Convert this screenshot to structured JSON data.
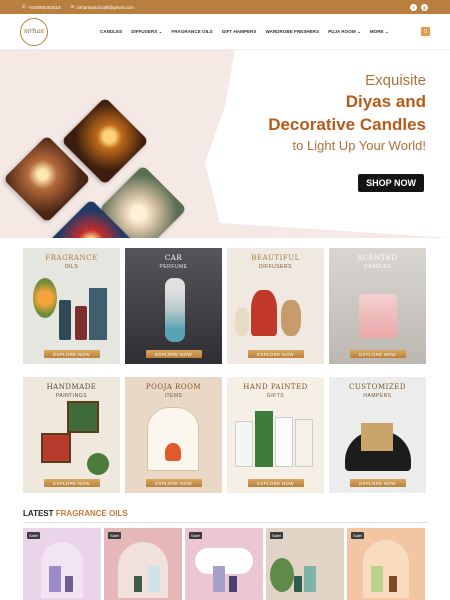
{
  "topbar": {
    "phone": "+916006263018",
    "email": "nirhanhandicraft@gmail.com"
  },
  "nav": {
    "logo_text": "nirhan",
    "items": [
      "CANDLES",
      "DIFFUSERS ⌄",
      "FRAGRANCE OILS",
      "GIFT HAMPERS",
      "WARDROBE FRESHERS",
      "PUJA ROOM ⌄",
      "MORE ⌄"
    ],
    "cart_count": "0"
  },
  "hero": {
    "line1": "Exquisite",
    "line2": "Diyas and",
    "line3": "Decorative Candles",
    "line4": "to Light Up Your World!",
    "button": "SHOP NOW"
  },
  "categories": [
    {
      "title": "FRAGRANCE",
      "sub": "OILS",
      "button": "EXPLORE NOW",
      "bg": "#e6e6e0",
      "title_color": "#a77b48"
    },
    {
      "title": "CAR",
      "sub": "PERFUME",
      "button": "EXPLORE NOW",
      "bg": "#4c4c52",
      "title_color": "#ffffff"
    },
    {
      "title": "BEAUTIFUL",
      "sub": "DIFFUSERS",
      "button": "EXPLORE NOW",
      "bg": "#efe9e1",
      "title_color": "#a77b48"
    },
    {
      "title": "SCENTED",
      "sub": "CANDLES",
      "button": "EXPLORE NOW",
      "bg": "#d9d6d2",
      "title_color": "#ffffff"
    },
    {
      "title": "HANDMADE",
      "sub": "PAINTINGS",
      "button": "EXPLORE NOW",
      "bg": "#eee8dd",
      "title_color": "#5a4630"
    },
    {
      "title": "POOJA ROOM",
      "sub": "ITEMS",
      "button": "EXPLORE NOW",
      "bg": "#e9d8c5",
      "title_color": "#7a5228"
    },
    {
      "title": "HAND PAINTED",
      "sub": "GIFTS",
      "button": "EXPLORE NOW",
      "bg": "#f6efe6",
      "title_color": "#7a5228"
    },
    {
      "title": "CUSTOMIZED",
      "sub": "HAMPERS",
      "button": "EXPLORE NOW",
      "bg": "#ececec",
      "title_color": "#7a5228"
    }
  ],
  "latest": {
    "prefix": "LATEST",
    "highlight": "FRAGRANCE OILS"
  },
  "products": [
    {
      "badge": "Sale!",
      "bg": "#ead4ea"
    },
    {
      "badge": "Sale!",
      "bg": "#e5b7b7"
    },
    {
      "badge": "Sale!",
      "bg": "#ecc6d2"
    },
    {
      "badge": "Sale!",
      "bg": "#e1d3c6"
    },
    {
      "badge": "Sale!",
      "bg": "#f3c6a3"
    }
  ],
  "icons": [
    "phone-icon",
    "mail-icon",
    "facebook-icon",
    "instagram-icon",
    "cart-icon"
  ]
}
